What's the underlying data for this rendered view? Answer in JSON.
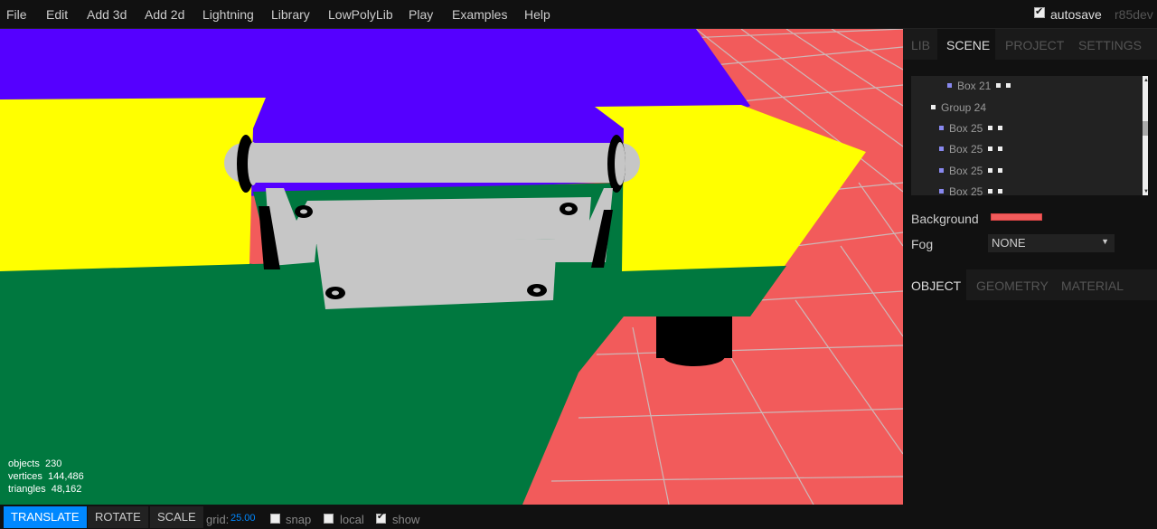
{
  "menubar": {
    "items": [
      "File",
      "Edit",
      "Add 3d",
      "Add 2d",
      "Lightning",
      "Library",
      "LowPolyLib",
      "Play",
      "Examples",
      "Help"
    ],
    "autosave_label": "autosave",
    "autosave_checked": true,
    "version": "r85dev"
  },
  "viewport": {
    "info": {
      "objects_label": "objects",
      "objects_value": "230",
      "vertices_label": "vertices",
      "vertices_value": "144,486",
      "triangles_label": "triangles",
      "triangles_value": "48,162"
    },
    "background_color": "#f25b5b"
  },
  "sidebar": {
    "top_tabs": [
      "LIB",
      "SCENE",
      "PROJECT",
      "SETTINGS"
    ],
    "selected_top_tab": "SCENE",
    "outliner": [
      {
        "label": "Box 21",
        "type": "mesh"
      },
      {
        "label": "Group 24",
        "type": "group"
      },
      {
        "label": "Box 25",
        "type": "mesh"
      },
      {
        "label": "Box 25",
        "type": "mesh"
      },
      {
        "label": "Box 25",
        "type": "mesh"
      },
      {
        "label": "Box 25",
        "type": "mesh"
      }
    ],
    "background_label": "Background",
    "background_color": "#f25b5b",
    "fog_label": "Fog",
    "fog_value": "NONE",
    "bottom_tabs": [
      "OBJECT",
      "GEOMETRY",
      "MATERIAL"
    ],
    "selected_bottom_tab": "OBJECT"
  },
  "toolbar": {
    "translate": "TRANSLATE",
    "rotate": "ROTATE",
    "scale": "SCALE",
    "grid_label": "grid:",
    "grid_value": "25.00",
    "snap_label": "snap",
    "snap_checked": false,
    "local_label": "local",
    "local_checked": false,
    "show_label": "show",
    "show_checked": true
  }
}
